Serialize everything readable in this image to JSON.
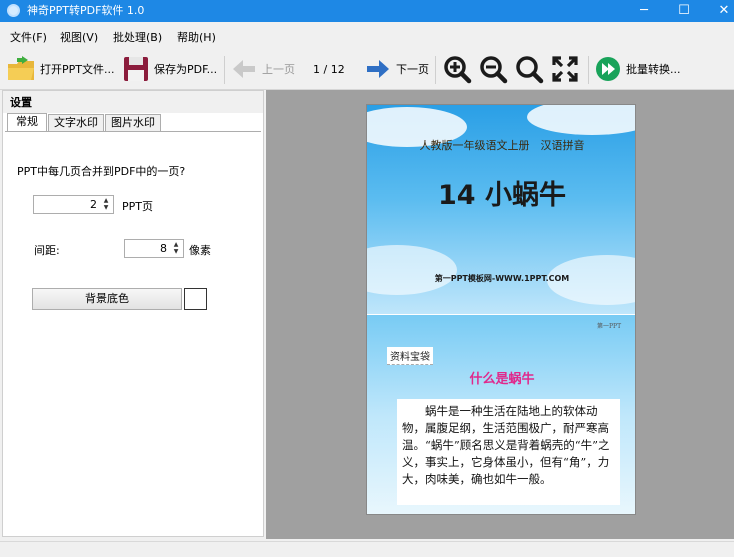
{
  "window": {
    "title": "神奇PPT转PDF软件 1.0",
    "minimize": "─",
    "maximize": "☐",
    "close": "✕"
  },
  "menu": [
    "文件(F)",
    "视图(V)",
    "批处理(B)",
    "帮助(H)"
  ],
  "toolbar": {
    "open": "打开PPT文件...",
    "save": "保存为PDF...",
    "prev": "上一页",
    "page_indicator": "1 / 12",
    "next": "下一页",
    "batch": "批量转换...",
    "icons": [
      "folder-open-icon",
      "save-disk-icon",
      "arrow-left-icon",
      "arrow-right-icon",
      "zoom-in-icon",
      "zoom-out-icon",
      "zoom-icon",
      "fit-screen-icon",
      "batch-convert-icon"
    ]
  },
  "settings": {
    "header": "设置",
    "tabs": [
      "常规",
      "文字水印",
      "图片水印"
    ],
    "question": "PPT中每几页合并到PDF中的一页?",
    "pages_per_sheet": "2",
    "pages_unit": "PPT页",
    "spacing_label": "间距:",
    "spacing_value": "8",
    "spacing_unit": "像素",
    "bg_button": "背景底色",
    "bg_color": "#ffffff"
  },
  "preview": {
    "slide1": {
      "subtitle": "人教版一年级语文上册　汉语拼音",
      "title": "14 小蜗牛",
      "footer": "第一PPT模板网-WWW.1PPT.COM"
    },
    "slide2": {
      "brand": "第一PPT",
      "tag": "资料宝袋",
      "heading": "什么是蜗牛",
      "body": "蜗牛是一种生活在陆地上的软体动物，属腹足纲，生活范围极广，耐严寒高温。“蜗牛”顾名思义是背着蜗壳的“牛”之义，事实上，它身体虽小，但有“角”，力大，肉味美，确也如牛一般。"
    }
  },
  "colors": {
    "titlebar": "#1e88e5",
    "accent_pink": "#e0298c",
    "nav_arrow": "#2f6fc4",
    "batch_green": "#19a35a"
  }
}
